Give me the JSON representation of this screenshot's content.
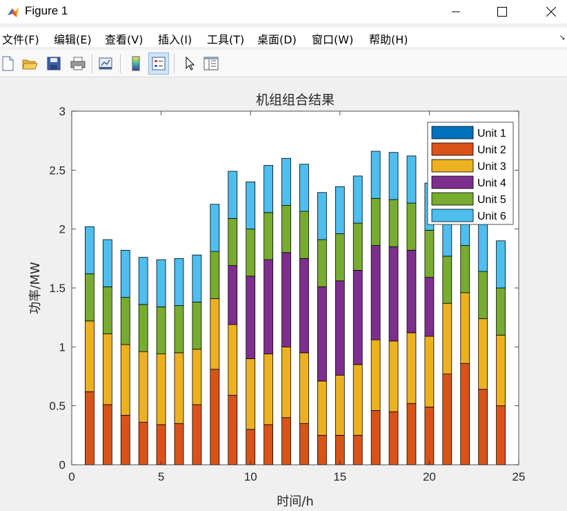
{
  "window": {
    "title": "Figure 1",
    "minimize_glyph": "—",
    "maximize_glyph": "☐",
    "close_glyph": "✕"
  },
  "menu": {
    "items": [
      "文件(F)",
      "编辑(E)",
      "查看(V)",
      "插入(I)",
      "工具(T)",
      "桌面(D)",
      "窗口(W)",
      "帮助(H)"
    ],
    "pin_glyph": "➘"
  },
  "toolbar": {
    "icons": [
      "new-figure-icon",
      "open-file-icon",
      "save-icon",
      "print-icon",
      "link-icon",
      "colorbar-icon",
      "legend-icon",
      "pointer-icon",
      "property-inspector-icon"
    ]
  },
  "colors": {
    "unit1": "#0072BD",
    "unit2": "#D95319",
    "unit3": "#EDB120",
    "unit4": "#7E2F8E",
    "unit5": "#77AC30",
    "unit6": "#4DBEEE"
  },
  "chart_data": {
    "type": "bar",
    "stacked": true,
    "title": "机组组合结果",
    "xlabel": "时间/h",
    "ylabel": "功率/MW",
    "xlim": [
      0,
      25
    ],
    "ylim": [
      0,
      3
    ],
    "xticks": [
      0,
      5,
      10,
      15,
      20,
      25
    ],
    "yticks": [
      0,
      0.5,
      1,
      1.5,
      2,
      2.5,
      3
    ],
    "ytick_labels": [
      "0",
      "0.5",
      "1",
      "1.5",
      "2",
      "2.5",
      "3"
    ],
    "grid": false,
    "legend_position": "top-right",
    "categories": [
      1,
      2,
      3,
      4,
      5,
      6,
      7,
      8,
      9,
      10,
      11,
      12,
      13,
      14,
      15,
      16,
      17,
      18,
      19,
      20,
      21,
      22,
      23,
      24
    ],
    "series": [
      {
        "name": "Unit 1",
        "values": [
          0,
          0,
          0,
          0,
          0,
          0,
          0,
          0,
          0,
          0,
          0,
          0,
          0,
          0,
          0,
          0,
          0,
          0,
          0,
          0,
          0,
          0,
          0,
          0
        ]
      },
      {
        "name": "Unit 2",
        "values": [
          0.62,
          0.51,
          0.42,
          0.36,
          0.34,
          0.35,
          0.51,
          0.81,
          0.59,
          0.3,
          0.34,
          0.4,
          0.35,
          0.25,
          0.25,
          0.25,
          0.46,
          0.45,
          0.52,
          0.49,
          0.77,
          0.86,
          0.64,
          0.5
        ]
      },
      {
        "name": "Unit 3",
        "values": [
          0.6,
          0.6,
          0.6,
          0.6,
          0.6,
          0.6,
          0.47,
          0.6,
          0.6,
          0.6,
          0.6,
          0.6,
          0.6,
          0.46,
          0.51,
          0.6,
          0.6,
          0.6,
          0.6,
          0.6,
          0.6,
          0.6,
          0.6,
          0.6
        ]
      },
      {
        "name": "Unit 4",
        "values": [
          0,
          0,
          0,
          0,
          0,
          0,
          0,
          0,
          0.5,
          0.7,
          0.8,
          0.8,
          0.8,
          0.8,
          0.8,
          0.8,
          0.8,
          0.8,
          0.7,
          0.5,
          0,
          0,
          0,
          0
        ]
      },
      {
        "name": "Unit 5",
        "values": [
          0.4,
          0.4,
          0.4,
          0.4,
          0.4,
          0.4,
          0.4,
          0.4,
          0.4,
          0.4,
          0.4,
          0.4,
          0.4,
          0.4,
          0.4,
          0.4,
          0.4,
          0.4,
          0.4,
          0.4,
          0.4,
          0.4,
          0.4,
          0.4
        ]
      },
      {
        "name": "Unit 6",
        "values": [
          0.4,
          0.4,
          0.4,
          0.4,
          0.4,
          0.4,
          0.4,
          0.4,
          0.4,
          0.4,
          0.4,
          0.4,
          0.4,
          0.4,
          0.4,
          0.4,
          0.4,
          0.4,
          0.4,
          0.4,
          0.4,
          0.4,
          0.4,
          0.4
        ]
      }
    ]
  }
}
